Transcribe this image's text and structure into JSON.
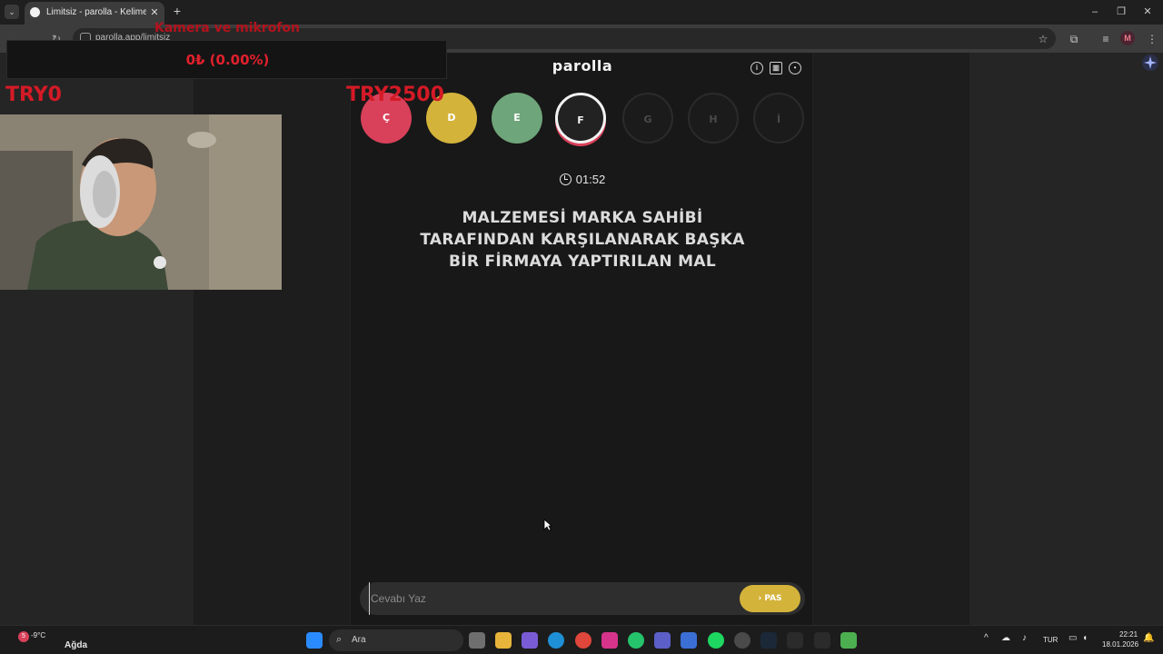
{
  "browser": {
    "tab_title": "Limitsiz - parolla - Kelime oyunu",
    "url": "parolla.app/limitsiz",
    "profile_initial": "M"
  },
  "overlay": {
    "title": "Kamera ve mikrofon",
    "value": "0₺ (0.00%)",
    "try_left": "TRY0",
    "try_right": "TRY2500"
  },
  "game": {
    "logo": "parolla",
    "header_icons": [
      "info-icon",
      "chart-icon",
      "account-icon"
    ],
    "letters": [
      {
        "char": "Ç",
        "state": "wrong",
        "color": "#d9415a"
      },
      {
        "char": "D",
        "state": "passed",
        "color": "#d4b33b"
      },
      {
        "char": "E",
        "state": "correct",
        "color": "#6fa57a"
      },
      {
        "char": "F",
        "state": "active",
        "color": "#f2f2f2"
      },
      {
        "char": "G",
        "state": "pending",
        "color": "#4a4a4a"
      },
      {
        "char": "H",
        "state": "pending",
        "color": "#4a4a4a"
      },
      {
        "char": "İ",
        "state": "pending",
        "color": "#4a4a4a"
      }
    ],
    "timer": "01:52",
    "question_lines": [
      "MALZEMESİ MARKA SAHİBİ",
      "TARAFINDAN KARŞILANARAK BAŞKA",
      "BİR FİRMAYA YAPTIRILAN MAL"
    ],
    "answer_placeholder": "Cevabı Yaz",
    "pass_label": "PAS"
  },
  "taskbar": {
    "weather_temp": "-9°C",
    "weather_label": "Ağda",
    "notification_count": "5",
    "search_placeholder": "Ara",
    "language": "TUR",
    "time": "22:21",
    "date": "18.01.2026"
  }
}
